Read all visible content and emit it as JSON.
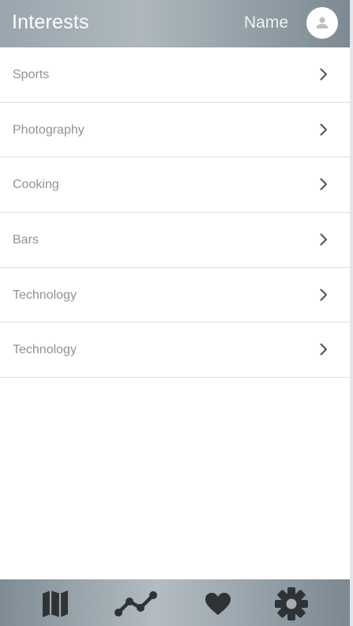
{
  "header": {
    "title": "Interests",
    "name": "Name",
    "avatar_icon": "user-avatar-icon"
  },
  "interests": [
    {
      "label": "Sports"
    },
    {
      "label": "Photography"
    },
    {
      "label": "Cooking"
    },
    {
      "label": "Bars"
    },
    {
      "label": "Technology"
    },
    {
      "label": "Technology"
    }
  ],
  "bottom_nav": [
    {
      "icon": "map-icon"
    },
    {
      "icon": "trend-line-icon"
    },
    {
      "icon": "heart-icon"
    },
    {
      "icon": "gear-icon"
    }
  ],
  "colors": {
    "header_gradient": [
      "#9aa6ae",
      "#7d8a93"
    ],
    "nav_icon": "#2f3336",
    "item_text": "#8f9396",
    "chevron": "#555a5e"
  }
}
